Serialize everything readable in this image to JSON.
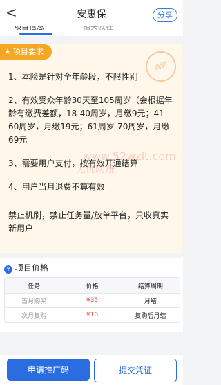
{
  "header": {
    "back": "<",
    "title": "安惠保",
    "share": "分享"
  },
  "tabs": [
    {
      "label": "项目信息"
    },
    {
      "label": "相关教程"
    }
  ],
  "requirements": {
    "badge": "项目要求",
    "stamp": "高佣",
    "items": [
      "1、本险是针对全年龄段，不限性别",
      "2、有效受众年龄30天至105周岁（会根据年龄有缴费差额，18-40周岁，月缴9元；41-60周岁，月缴19元；61周岁-70周岁，月缴69元",
      "3、需要用户支付，按有效开通结算",
      "4、用户当月退费不算有效",
      "禁止机刷，禁止任务量/放单平台，只收真实新用户"
    ],
    "watermark_1": "www.52wzlt.com",
    "watermark_2": "无忧网赚"
  },
  "pricing": {
    "title": "项目价格",
    "headers": [
      "任务",
      "价格",
      "结算周期"
    ],
    "rows": [
      [
        "首月购买",
        "¥35",
        "月结"
      ],
      [
        "次月复购",
        "¥10",
        "复购后月结"
      ]
    ]
  },
  "actions": {
    "primary": "申请推广码",
    "secondary": "提交凭证"
  },
  "colors": {
    "primary": "#2a6de1",
    "badge": "#f5a623",
    "card_bg": "#fff8ea",
    "price": "#e24a3b"
  }
}
